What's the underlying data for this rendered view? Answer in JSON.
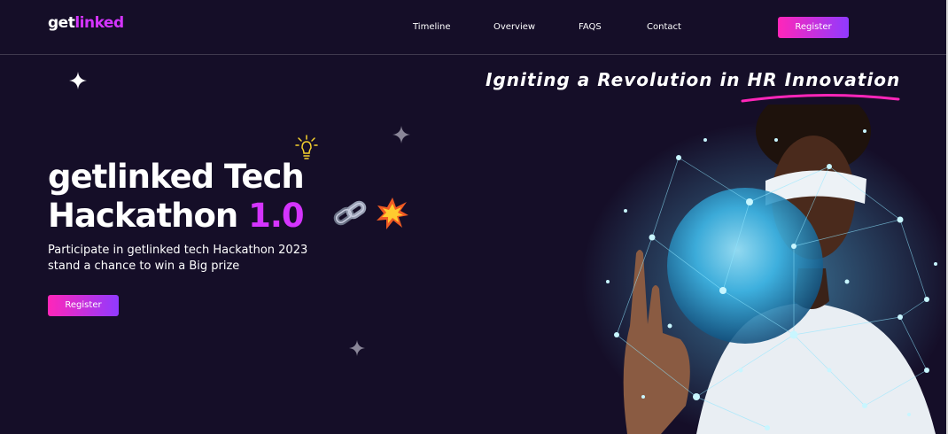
{
  "brand": {
    "get": "get",
    "linked": "linked"
  },
  "nav": {
    "links": [
      "Timeline",
      "Overview",
      "FAQS",
      "Contact"
    ],
    "register_label": "Register"
  },
  "hero": {
    "tagline": "Igniting a Revolution in HR Innovation",
    "title_line1": "getlinked Tech",
    "title_line2": "Hackathon",
    "title_version": "1.0",
    "description": "Participate in getlinked tech Hackathon 2023 stand a chance to win a Big prize",
    "register_label": "Register"
  },
  "icons": [
    "star-icon",
    "lightbulb-icon",
    "chain-icon",
    "collision-icon"
  ],
  "colors": {
    "background": "#150e28",
    "accent_purple": "#d434fe",
    "gradient_start": "#ff26b9",
    "gradient_end": "#903aff"
  }
}
